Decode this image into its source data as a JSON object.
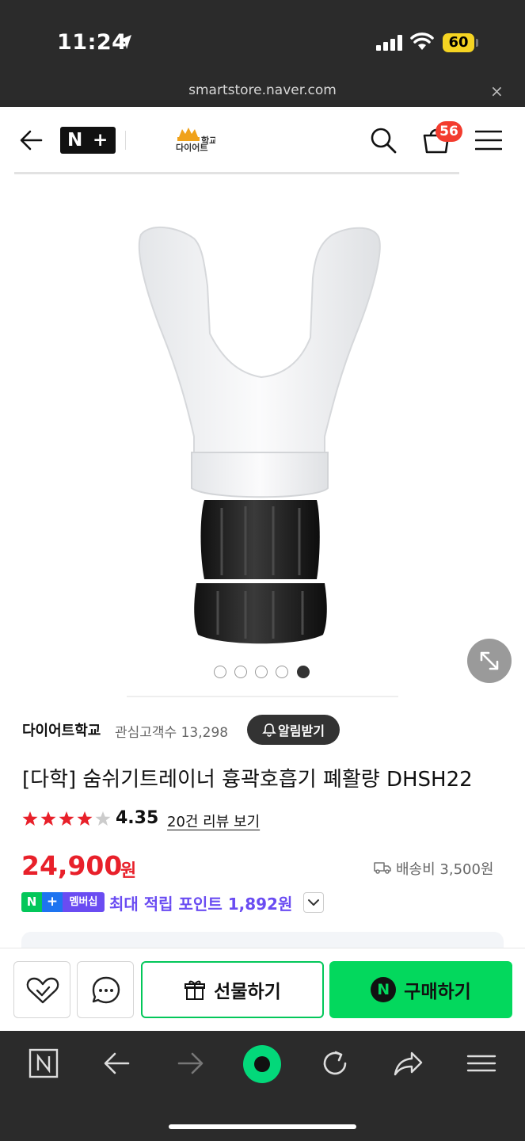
{
  "status_bar": {
    "time": "11:24",
    "battery": "60"
  },
  "url_bar": {
    "url": "smartstore.naver.com",
    "close_label": "×"
  },
  "header": {
    "cart_count": "56",
    "store_logo_text": "다이어트"
  },
  "carousel": {
    "total": 5,
    "active_index": 4
  },
  "store": {
    "name": "다이어트학교",
    "interest_label": "관심고객수 13,298",
    "alarm_label": "알림받기"
  },
  "product": {
    "title": "[다학] 숨쉬기트레이너 흉곽호흡기 폐활량 DHSH22",
    "rating": "4.35",
    "rating_value": 4.35,
    "review_link": "20건 리뷰 보기",
    "price": "24,900",
    "price_unit": "원",
    "shipping": "배송비 3,500원"
  },
  "membership": {
    "badge_n": "N",
    "badge_plus": "+",
    "badge_text": "멤버십",
    "point_text": "최대 적립 포인트 1,892원"
  },
  "actions": {
    "gift_label": "선물하기",
    "buy_label": "구매하기",
    "buy_badge": "N"
  },
  "colors": {
    "price": "#e8202a",
    "brand_green": "#03c75a",
    "buy_green": "#03d85d",
    "membership": "#6a4cf2",
    "badge": "#f33c2e"
  },
  "bottom_bar": {
    "items": [
      "n-home-icon",
      "back-icon",
      "forward-icon",
      "green-dot-icon",
      "reload-icon",
      "share-icon",
      "menu-icon"
    ]
  }
}
